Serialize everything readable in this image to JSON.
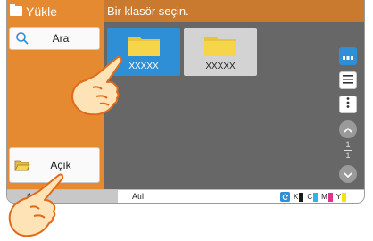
{
  "sidebar": {
    "title": "Yükle",
    "title_icon": "folder-icon",
    "search_label": "Ara",
    "search_icon": "magnifier-icon",
    "open_label": "Açık",
    "open_icon": "open-folder-icon"
  },
  "header": {
    "title": "Bir klasör seçin."
  },
  "folders": [
    {
      "name": "XXXXX",
      "selected": true
    },
    {
      "name": "XXXXX",
      "selected": false
    }
  ],
  "view_controls": {
    "grid_icon": "grid-view-icon",
    "list_icon": "list-view-icon",
    "more_icon": "more-options-icon"
  },
  "pager": {
    "current": "1",
    "total": "1"
  },
  "status": {
    "left_text": "th",
    "skip_label": "Atıl",
    "toner": [
      {
        "label": "K",
        "color": "#1a1a1a"
      },
      {
        "label": "C",
        "color": "#29b6e8"
      },
      {
        "label": "M",
        "color": "#e0338f"
      },
      {
        "label": "Y",
        "color": "#f2e21a"
      }
    ]
  },
  "colors": {
    "accent_orange": "#e58a30",
    "header_orange": "#c97a2e",
    "selection_blue": "#2f8fd6",
    "folder_yellow": "#f7d54a"
  }
}
